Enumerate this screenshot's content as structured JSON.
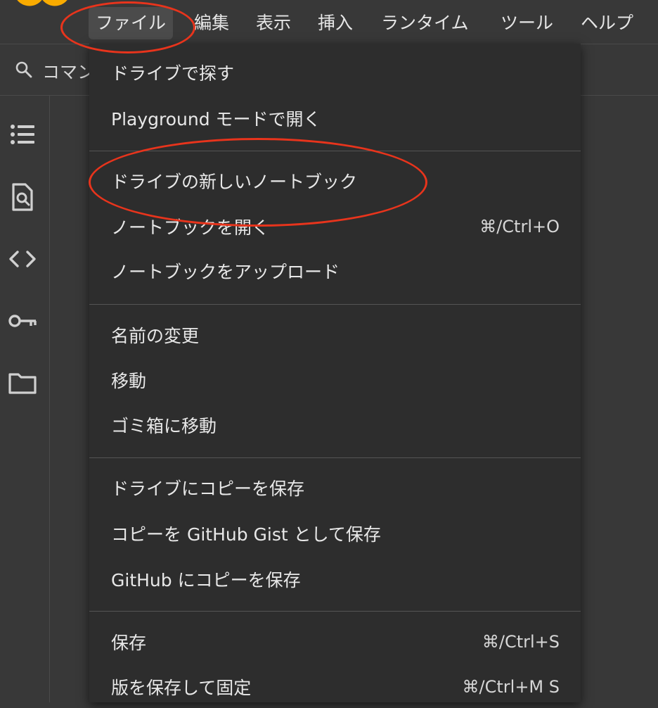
{
  "menubar": {
    "items": [
      {
        "label": "ファイル"
      },
      {
        "label": "編集"
      },
      {
        "label": "表示"
      },
      {
        "label": "挿入"
      },
      {
        "label": "ランタイム"
      },
      {
        "label": "ツール"
      },
      {
        "label": "ヘルプ"
      }
    ]
  },
  "search": {
    "text": "コマン"
  },
  "sidebar": {
    "icons": [
      "table-of-contents-icon",
      "find-in-file-icon",
      "code-icon",
      "key-icon",
      "folder-icon"
    ]
  },
  "file_menu": {
    "items": [
      {
        "label": "ドライブで探す",
        "shortcut": ""
      },
      {
        "label": "Playground モードで開く",
        "shortcut": ""
      },
      {
        "label": "ドライブの新しいノートブック",
        "shortcut": ""
      },
      {
        "label": "ノートブックを開く",
        "shortcut": "⌘/Ctrl+O"
      },
      {
        "label": "ノートブックをアップロード",
        "shortcut": ""
      },
      {
        "label": "名前の変更",
        "shortcut": ""
      },
      {
        "label": "移動",
        "shortcut": ""
      },
      {
        "label": "ゴミ箱に移動",
        "shortcut": ""
      },
      {
        "label": "ドライブにコピーを保存",
        "shortcut": ""
      },
      {
        "label": "コピーを GitHub Gist として保存",
        "shortcut": ""
      },
      {
        "label": "GitHub にコピーを保存",
        "shortcut": ""
      },
      {
        "label": "保存",
        "shortcut": "⌘/Ctrl+S"
      },
      {
        "label": "版を保存して固定",
        "shortcut": "⌘/Ctrl+M S"
      }
    ]
  },
  "colors": {
    "background": "#383838",
    "menu_background": "#2d2d2d",
    "logo_orange": "#f9ab00",
    "annotation_red": "#e8341c"
  }
}
